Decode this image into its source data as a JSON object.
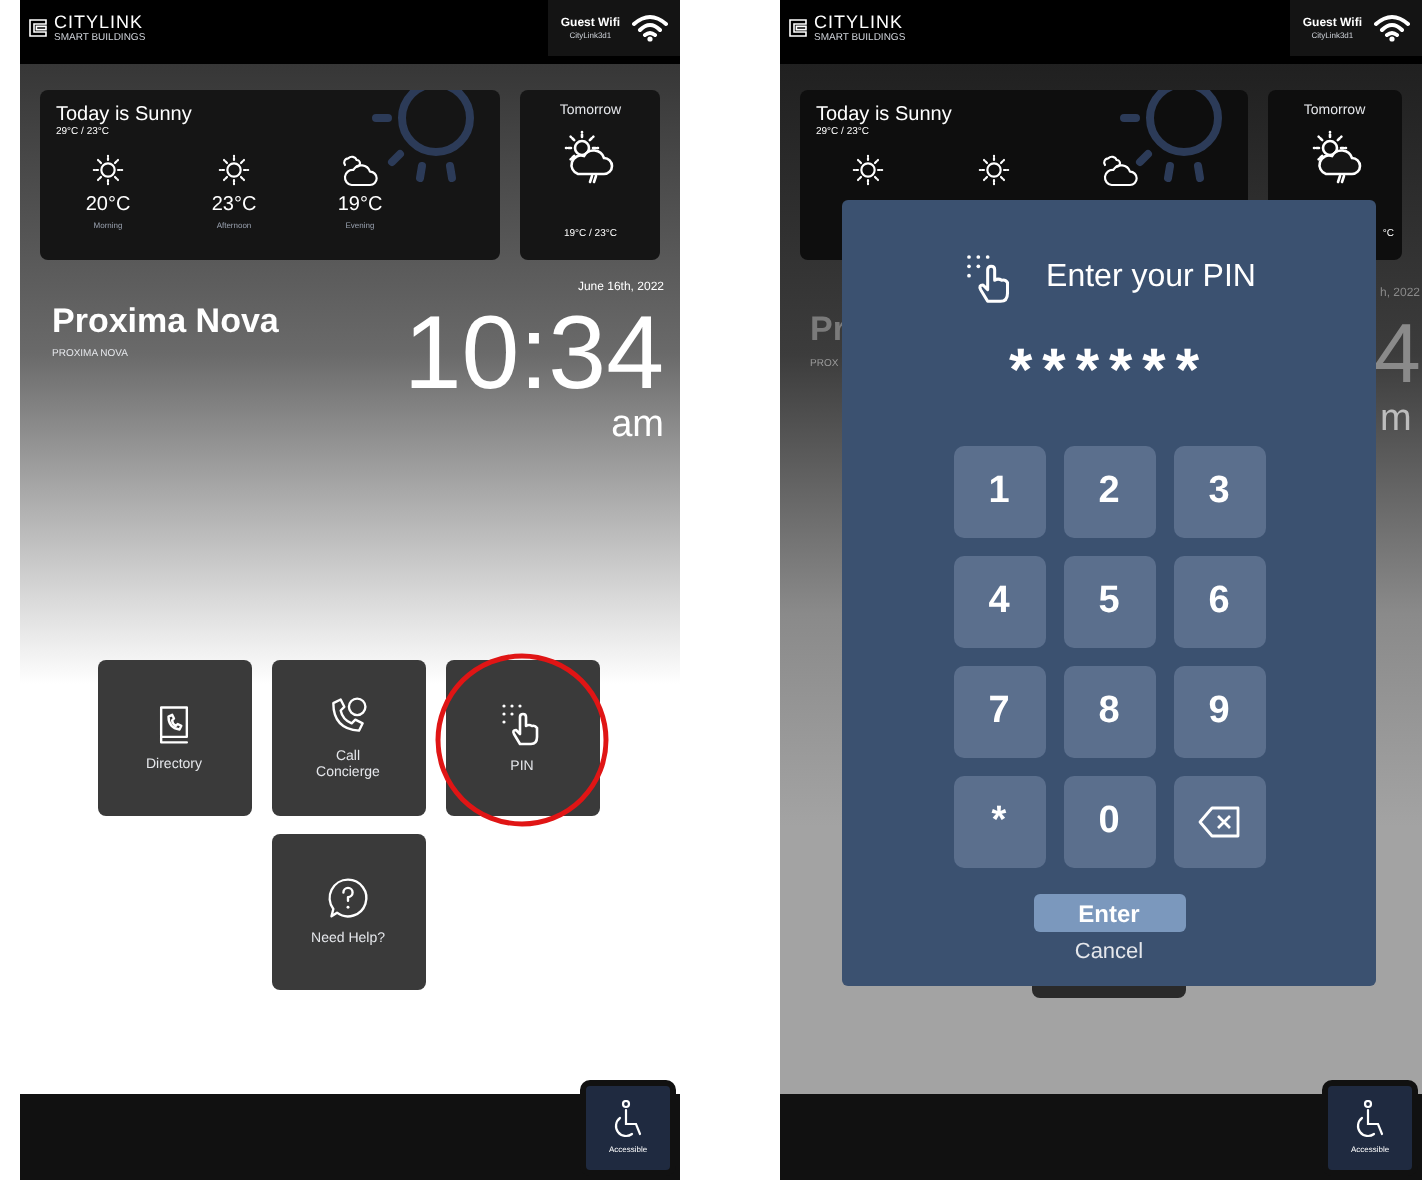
{
  "screens": [
    {
      "kind": "home",
      "header": {
        "brand": "CITYLINK",
        "tagline": "SMART BUILDINGS",
        "wifi_name": "Guest Wifi",
        "wifi_password": "CityLink3d1"
      },
      "today": {
        "title": "Today is Sunny",
        "range": "29°C / 23°C",
        "periods": [
          {
            "kind": "sunny",
            "temp": "20°C",
            "label": "Morning"
          },
          {
            "kind": "sunny",
            "temp": "23°C",
            "label": "Afternoon"
          },
          {
            "kind": "cloudy",
            "temp": "19°C",
            "label": "Evening"
          }
        ]
      },
      "tomorrow": {
        "title": "Tomorrow",
        "range": "19°C / 23°C"
      },
      "date": "June 16th, 2022",
      "building": "Proxima Nova",
      "building_caption": "PROXIMA NOVA",
      "time": "10:34",
      "meridiem": "am",
      "tiles": [
        {
          "kind": "directory",
          "label": "Directory",
          "highlighted": false
        },
        {
          "kind": "concierge",
          "label": "Call Concierge",
          "highlighted": false
        },
        {
          "kind": "pin",
          "label": "PIN",
          "highlighted": true
        },
        {
          "kind": "help",
          "label": "Need Help?",
          "highlighted": false
        }
      ],
      "accessible": "Accessible"
    },
    {
      "kind": "pin_entry",
      "header": {
        "brand": "CITYLINK",
        "tagline": "SMART BUILDINGS",
        "wifi_name": "Guest Wifi",
        "wifi_password": "CityLink3d1"
      },
      "today": {
        "title": "Today is Sunny",
        "range": "29°C / 23°C",
        "periods": [
          {
            "kind": "sunny"
          },
          {
            "kind": "sunny"
          },
          {
            "kind": "cloudy"
          }
        ]
      },
      "tomorrow": {
        "title": "Tomorrow",
        "range": "°C"
      },
      "fragments": {
        "building": "Pr",
        "caption": "PROX",
        "date": "h, 2022",
        "time": "4",
        "meridiem": "m"
      },
      "modal": {
        "title": "Enter your PIN",
        "masked": "******",
        "keys": [
          {
            "kind": "digit",
            "label": "1"
          },
          {
            "kind": "digit",
            "label": "2"
          },
          {
            "kind": "digit",
            "label": "3"
          },
          {
            "kind": "digit",
            "label": "4"
          },
          {
            "kind": "digit",
            "label": "5"
          },
          {
            "kind": "digit",
            "label": "6"
          },
          {
            "kind": "digit",
            "label": "7"
          },
          {
            "kind": "digit",
            "label": "8"
          },
          {
            "kind": "digit",
            "label": "9"
          },
          {
            "kind": "digit",
            "label": "*"
          },
          {
            "kind": "digit",
            "label": "0"
          },
          {
            "kind": "backspace"
          }
        ],
        "enter": "Enter",
        "cancel": "Cancel"
      },
      "accessible": "Accessible"
    }
  ]
}
